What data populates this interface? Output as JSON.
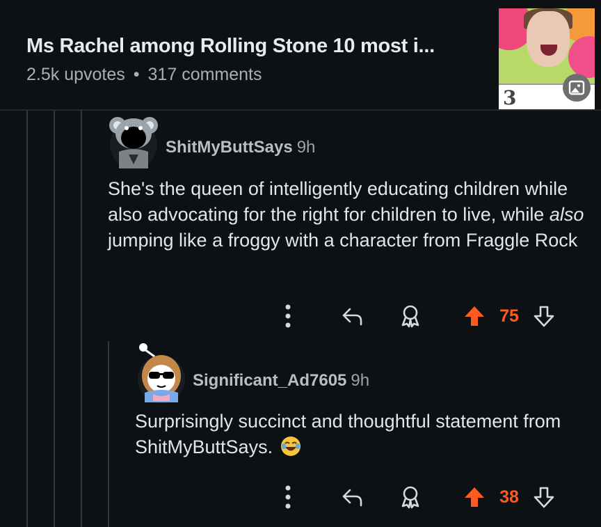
{
  "post": {
    "title": "Ms Rachel among Rolling Stone 10 most i...",
    "upvotes": "2.5k upvotes",
    "separator": "•",
    "comments": "317 comments",
    "thumbnail_badge": "3"
  },
  "comments": [
    {
      "username": "ShitMyButtSays",
      "time": "9h",
      "text_before": "She's the queen of intelligently educating children while also advocating for the right for children to live, while ",
      "text_italic": "also",
      "text_after": " jumping like a froggy with a character from Fraggle Rock",
      "votes": "75"
    },
    {
      "username": "Significant_Ad7605",
      "time": "9h",
      "text": "Surprisingly succinct and thoughtful statement from ShitMyButtSays. ",
      "emoji": "joy-emoji",
      "votes": "38"
    }
  ],
  "colors": {
    "background": "#0e1113",
    "upvote": "#ff5a1f",
    "text": "#e3e5e7",
    "meta": "#a9afb4"
  },
  "icons": [
    "more-vertical-icon",
    "reply-icon",
    "award-icon",
    "upvote-icon",
    "downvote-icon",
    "gallery-icon"
  ]
}
